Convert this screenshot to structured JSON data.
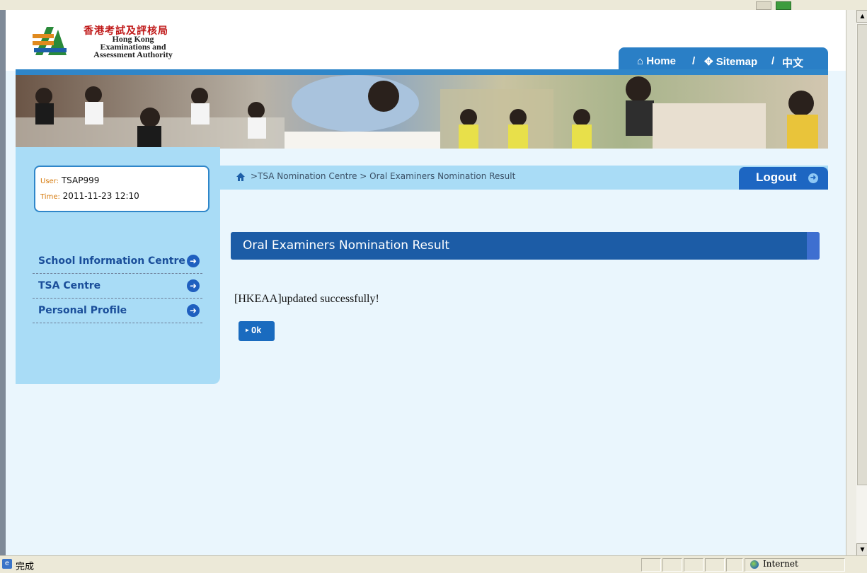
{
  "brand": {
    "name_zh": "香港考試及評核局",
    "name_en_line1": "Hong Kong",
    "name_en_line2": "Examinations and",
    "name_en_line3": "Assessment Authority"
  },
  "topnav": {
    "home": "Home",
    "sep1": "/",
    "sitemap": "Sitemap",
    "sep2": "/",
    "lang": "中文"
  },
  "user_panel": {
    "user_label": "User:",
    "user_value": "TSAP999",
    "time_label": "Time:",
    "time_value": "2011-11-23 12:10"
  },
  "sidebar": {
    "items": [
      {
        "label": "School Information Centre"
      },
      {
        "label": "TSA Centre"
      },
      {
        "label": "Personal Profile"
      }
    ]
  },
  "breadcrumb": {
    "text": ">TSA Nomination Centre > Oral Examiners Nomination Result"
  },
  "logout_label": "Logout",
  "section_title": "Oral Examiners Nomination Result",
  "message": "[HKEAA]updated successfully!",
  "ok_label": "Ok",
  "statusbar": {
    "text": "完成",
    "zone": "Internet"
  },
  "colors": {
    "accent": "#1c5ca6",
    "sidebar_bg": "#a9dcf6",
    "page_bg": "#eaf6fd"
  }
}
